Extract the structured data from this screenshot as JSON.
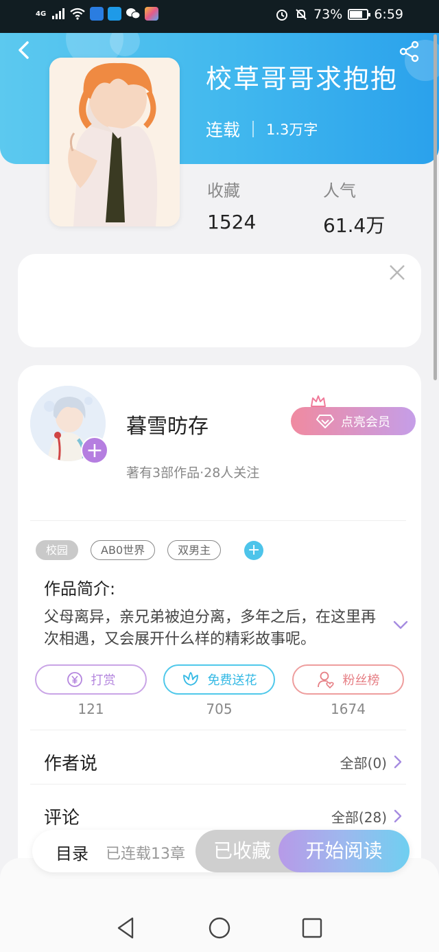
{
  "status_bar": {
    "network": "4G",
    "battery_percent": "73%",
    "battery_level": 0.73,
    "time": "6:59"
  },
  "book": {
    "title": "校草哥哥求抱抱",
    "status": "连载",
    "word_count": "1.3万字",
    "stats": [
      {
        "label": "收藏",
        "value": "1524"
      },
      {
        "label": "人气",
        "value": "61.4万"
      }
    ]
  },
  "author": {
    "name": "暮雪昉存",
    "meta": "著有3部作品·28人关注",
    "vip_button": "点亮会员"
  },
  "tags": [
    "校园",
    "AB0世界",
    "双男主"
  ],
  "intro": {
    "title": "作品简介:",
    "text": "父母离异，亲兄弟被迫分离，多年之后，在这里再次相遇，又会展开什么样的精彩故事呢。"
  },
  "actions": [
    {
      "label": "打赏",
      "count": "121",
      "icon": "yuan-coin-icon"
    },
    {
      "label": "免费送花",
      "count": "705",
      "icon": "flower-icon"
    },
    {
      "label": "粉丝榜",
      "count": "1674",
      "icon": "fan-user-icon"
    }
  ],
  "sections": [
    {
      "label": "作者说",
      "link": "全部(0)"
    },
    {
      "label": "评论",
      "link": "全部(28)"
    }
  ],
  "bottom_bar": {
    "toc": "目录",
    "chapters": "已连载13章",
    "collected": "已收藏",
    "read": "开始阅读"
  },
  "colors": {
    "header_blue": "#40b7ee",
    "accent_purple": "#b57ee0",
    "accent_cyan": "#4dc4ea",
    "accent_pink": "#e67e84"
  }
}
